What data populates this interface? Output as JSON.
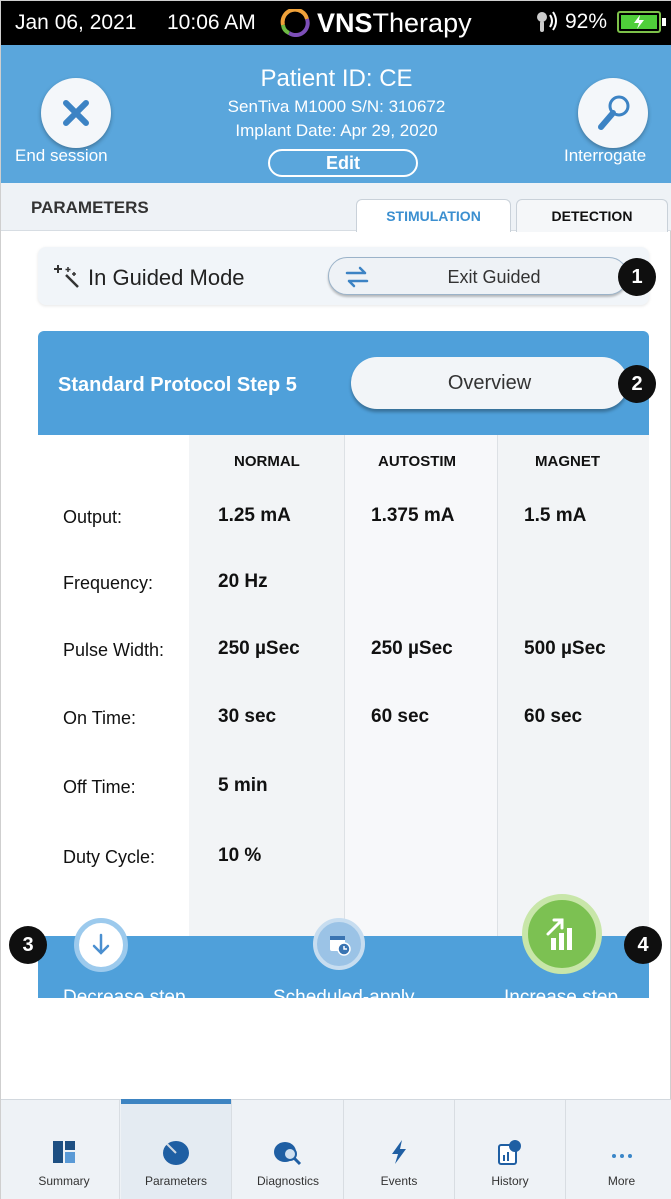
{
  "status_bar": {
    "date": "Jan 06, 2021",
    "time": "10:06 AM",
    "brand_bold": "VNS",
    "brand_light": "Therapy",
    "battery_percent": "92%",
    "battery_color": "#4fcf3a"
  },
  "header": {
    "patient_id": "Patient ID: CE",
    "model": "SenTiva M1000 S/N: 310672",
    "implant_date": "Implant Date: Apr 29, 2020",
    "edit_label": "Edit",
    "end_session_label": "End session",
    "interrogate_label": "Interrogate",
    "bg_color": "#5aa6dc"
  },
  "parameters": {
    "title": "PARAMETERS",
    "tabs": [
      {
        "label": "STIMULATION",
        "active": true
      },
      {
        "label": "DETECTION",
        "active": false
      }
    ]
  },
  "guided": {
    "mode_label": "In Guided Mode",
    "exit_label": "Exit Guided"
  },
  "protocol": {
    "step_title": "Standard Protocol Step 5",
    "overview_label": "Overview"
  },
  "table": {
    "columns": [
      "NORMAL",
      "AUTOSTIM",
      "MAGNET"
    ],
    "rows": [
      {
        "label": "Output:",
        "values": [
          "1.25 mA",
          "1.375 mA",
          "1.5 mA"
        ]
      },
      {
        "label": "Frequency:",
        "values": [
          "20 Hz",
          "",
          ""
        ]
      },
      {
        "label": "Pulse Width:",
        "values": [
          "250 µSec",
          "250 µSec",
          "500 µSec"
        ]
      },
      {
        "label": "On Time:",
        "values": [
          "30 sec",
          "60 sec",
          "60 sec"
        ]
      },
      {
        "label": "Off Time:",
        "values": [
          "5 min",
          "",
          ""
        ]
      },
      {
        "label": "Duty Cycle:",
        "values": [
          "10 %",
          "",
          ""
        ]
      }
    ]
  },
  "actions": {
    "decrease": "Decrease step",
    "scheduled": "Scheduled-apply",
    "increase": "Increase step"
  },
  "markers": [
    "1",
    "2",
    "3",
    "4"
  ],
  "nav": {
    "items": [
      {
        "label": "Summary",
        "icon": "summary-icon"
      },
      {
        "label": "Parameters",
        "icon": "parameters-icon"
      },
      {
        "label": "Diagnostics",
        "icon": "diagnostics-icon"
      },
      {
        "label": "Events",
        "icon": "events-icon"
      },
      {
        "label": "History",
        "icon": "history-icon"
      },
      {
        "label": "More",
        "icon": "more-icon"
      }
    ],
    "active": "Parameters"
  }
}
